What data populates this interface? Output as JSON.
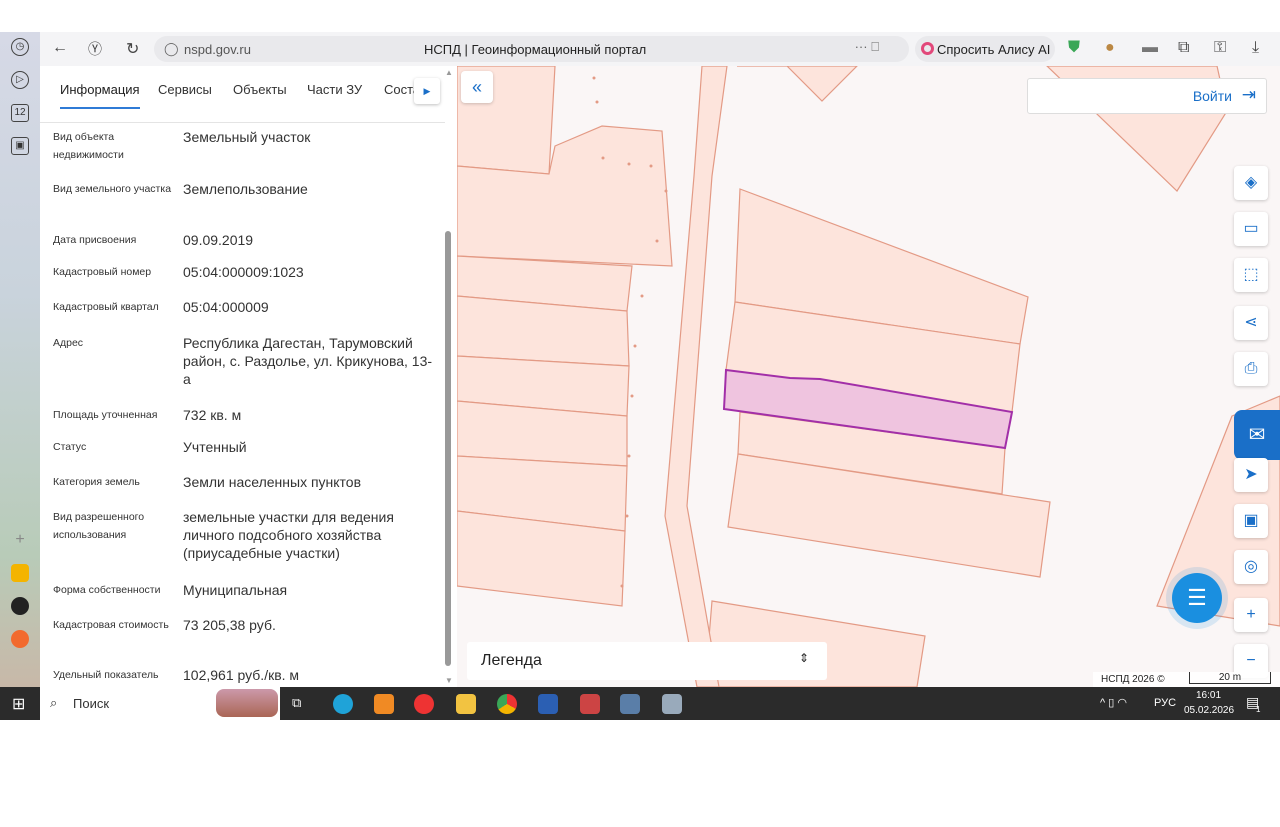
{
  "browser": {
    "url": "nspd.gov.ru",
    "title": "НСПД | Геоинформационный портал",
    "alice": "Спросить Алису AI"
  },
  "tabs": [
    "Информация",
    "Сервисы",
    "Объекты",
    "Части ЗУ",
    "Соста"
  ],
  "fields": [
    {
      "label": "Вид объекта недвижимости",
      "value": "Земельный участок"
    },
    {
      "label": "Вид земельного участка",
      "value": "Землепользование"
    },
    {
      "label": "Дата присвоения",
      "value": "09.09.2019"
    },
    {
      "label": "Кадастровый номер",
      "value": "05:04:000009:1023"
    },
    {
      "label": "Кадастровый квартал",
      "value": "05:04:000009"
    },
    {
      "label": "Адрес",
      "value": "Республика Дагестан, Тарумовский район, с. Раздолье, ул. Крикунова, 13-а"
    },
    {
      "label": "Площадь уточненная",
      "value": "732 кв. м"
    },
    {
      "label": "Статус",
      "value": "Учтенный"
    },
    {
      "label": "Категория земель",
      "value": "Земли населенных пунктов"
    },
    {
      "label": "Вид разрешенного использования",
      "value": "земельные участки для ведения личного подсобного хозяйства (приусадебные участки)"
    },
    {
      "label": "Форма собственности",
      "value": "Муниципальная"
    },
    {
      "label": "Кадастровая стоимость",
      "value": "73 205,38 руб."
    },
    {
      "label": "Удельный показатель",
      "value": "102,961 руб./кв. м"
    }
  ],
  "map": {
    "login": "Войти",
    "legend": "Легенда",
    "copyright": "НСПД 2026 ©",
    "scale": "20 m"
  },
  "taskbar": {
    "search": "Поиск",
    "lang": "РУС",
    "time": "16:01",
    "date": "05.02.2026",
    "notif": "1"
  }
}
